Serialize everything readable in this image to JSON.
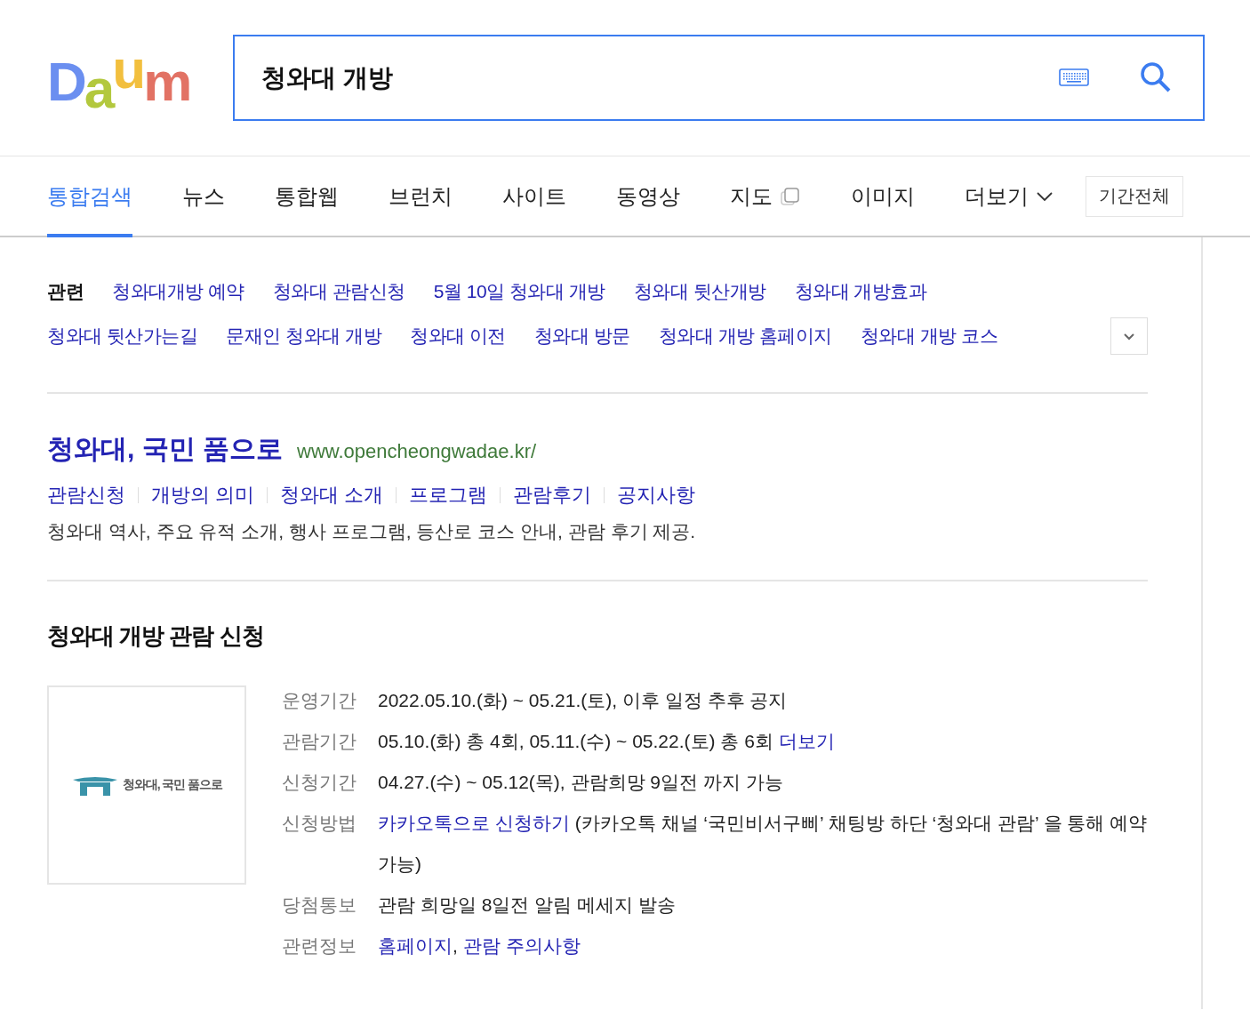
{
  "logo": {
    "letters": [
      {
        "text": "D",
        "color": "#6b8ff0"
      },
      {
        "text": "a",
        "color": "#b3c83e"
      },
      {
        "text": "u",
        "color": "#f2bf3e"
      },
      {
        "text": "m",
        "color": "#e27264"
      }
    ]
  },
  "search": {
    "value": "청와대 개방"
  },
  "tabs": [
    {
      "label": "통합검색",
      "selected": true,
      "kind": "plain"
    },
    {
      "label": "뉴스",
      "selected": false,
      "kind": "plain"
    },
    {
      "label": "통합웹",
      "selected": false,
      "kind": "plain"
    },
    {
      "label": "브런치",
      "selected": false,
      "kind": "plain"
    },
    {
      "label": "사이트",
      "selected": false,
      "kind": "plain"
    },
    {
      "label": "동영상",
      "selected": false,
      "kind": "plain"
    },
    {
      "label": "지도",
      "selected": false,
      "kind": "window"
    },
    {
      "label": "이미지",
      "selected": false,
      "kind": "plain"
    },
    {
      "label": "더보기",
      "selected": false,
      "kind": "dropdown"
    }
  ],
  "period_button": "기간전체",
  "related": {
    "label": "관련",
    "links": [
      "청와대개방 예약",
      "청와대 관람신청",
      "5월 10일 청와대 개방",
      "청와대 뒷산개방",
      "청와대 개방효과",
      "청와대 뒷산가는길",
      "문재인 청와대 개방",
      "청와대 이전",
      "청와대 방문",
      "청와대 개방 홈페이지",
      "청와대 개방 코스"
    ]
  },
  "site_result": {
    "title": "청와대, 국민 품으로",
    "url": "www.opencheongwadae.kr/",
    "links": [
      "관람신청",
      "개방의 의미",
      "청와대 소개",
      "프로그램",
      "관람후기",
      "공지사항"
    ],
    "description": "청와대 역사, 주요 유적 소개, 행사 프로그램, 등산로 코스 안내, 관람 후기 제공."
  },
  "info_card": {
    "title": "청와대 개방 관람 신청",
    "thumbnail_caption": "청와대, 국민 품으로",
    "rows": [
      {
        "label": "운영기간",
        "parts": [
          {
            "text": "2022.05.10.(화) ~ 05.21.(토), 이후 일정 추후 공지",
            "link": false
          }
        ]
      },
      {
        "label": "관람기간",
        "parts": [
          {
            "text": "05.10.(화) 총 4회, 05.11.(수) ~ 05.22.(토) 총 6회 ",
            "link": false
          },
          {
            "text": "더보기",
            "link": true
          }
        ]
      },
      {
        "label": "신청기간",
        "parts": [
          {
            "text": "04.27.(수) ~ 05.12(목), 관람희망 9일전 까지 가능",
            "link": false
          }
        ]
      },
      {
        "label": "신청방법",
        "parts": [
          {
            "text": "카카오톡으로 신청하기",
            "link": true
          },
          {
            "text": " (카카오톡 채널 ‘국민비서구삐’ 채팅방 하단 ‘청와대 관람’ 을 통해 예약 가능)",
            "link": false
          }
        ]
      },
      {
        "label": "당첨통보",
        "parts": [
          {
            "text": "관람 희망일 8일전 알림 메세지 발송",
            "link": false
          }
        ]
      },
      {
        "label": "관련정보",
        "parts": [
          {
            "text": "홈페이지",
            "link": true
          },
          {
            "text": ", ",
            "link": false
          },
          {
            "text": "관람 주의사항",
            "link": true
          }
        ]
      }
    ]
  }
}
